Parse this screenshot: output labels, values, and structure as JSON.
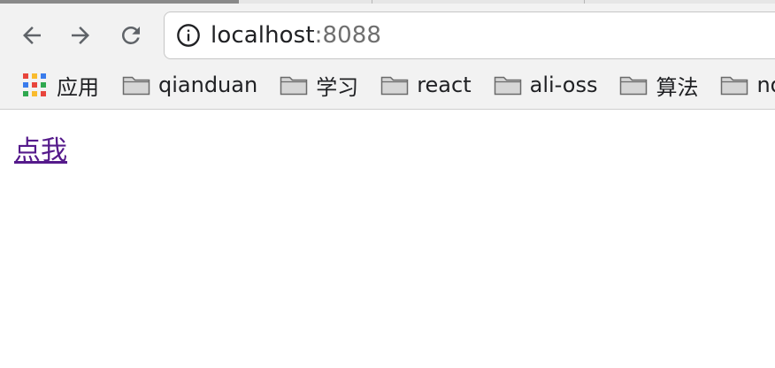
{
  "browser": {
    "url_host": "localhost",
    "url_port": ":8088",
    "icons": {
      "back": "back-arrow-icon",
      "forward": "forward-arrow-icon",
      "reload": "reload-icon",
      "site_info": "info-icon",
      "apps": "apps-grid-icon",
      "folder": "folder-icon"
    },
    "colors": {
      "icon_gray": "#5f6368",
      "link_visited": "#551a8b"
    }
  },
  "bookmarks": {
    "apps_label": "应用",
    "folders": [
      "qianduan",
      "学习",
      "react",
      "ali-oss",
      "算法",
      "no"
    ]
  },
  "page": {
    "link_text": "点我"
  }
}
